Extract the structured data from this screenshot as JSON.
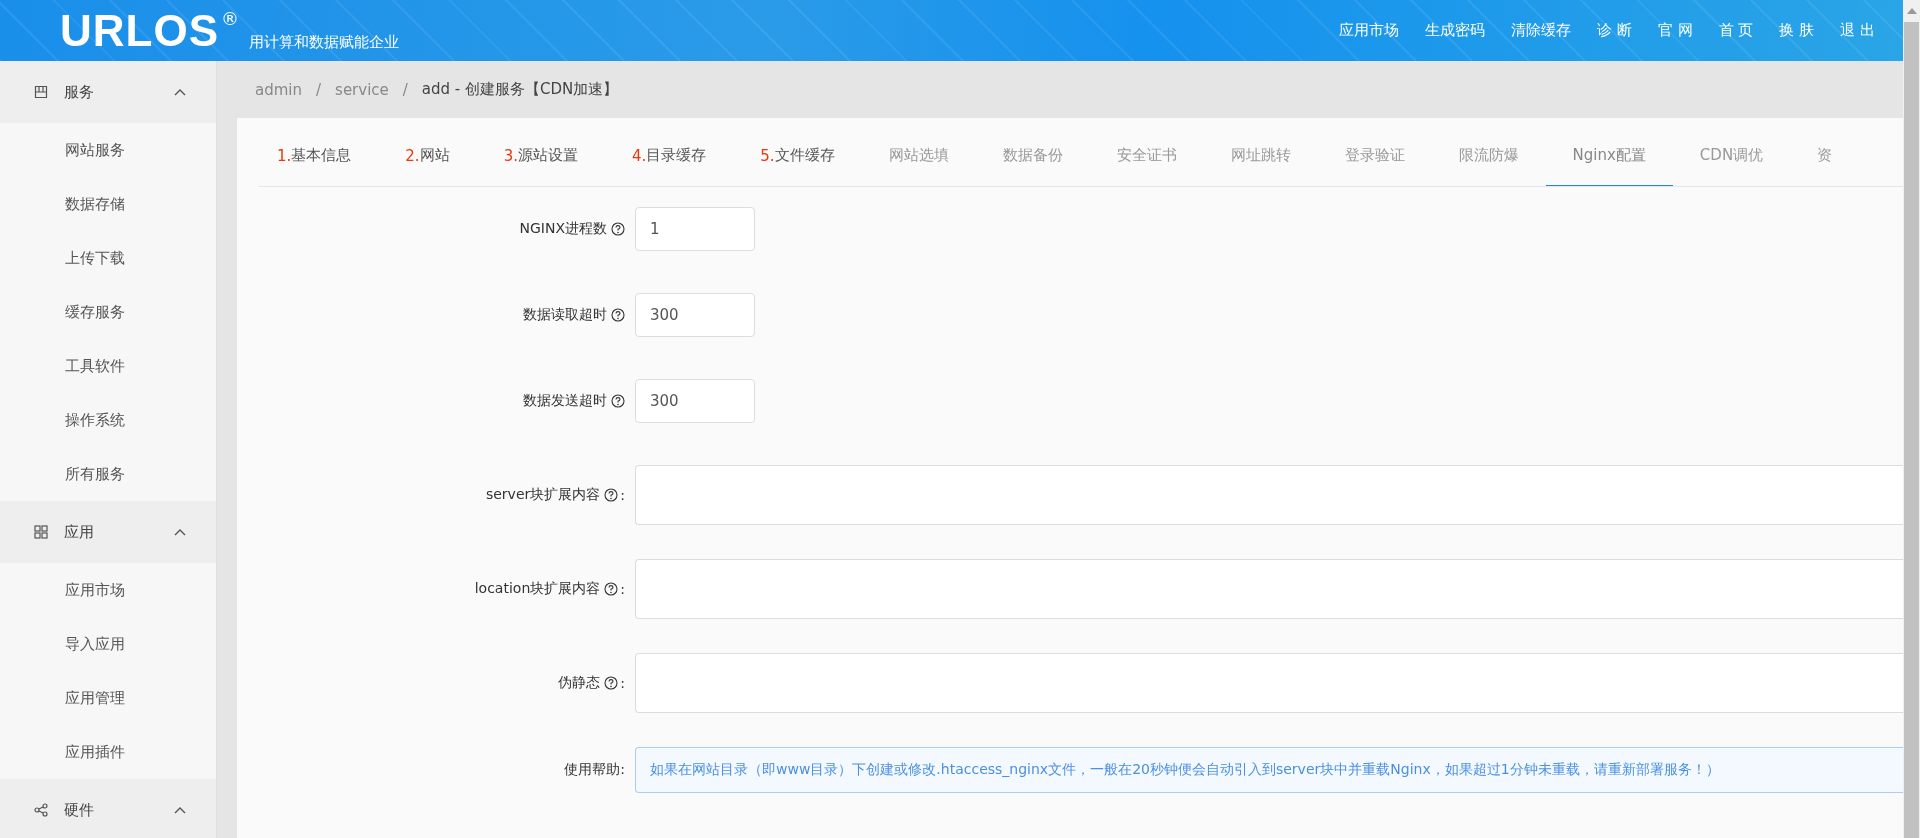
{
  "header": {
    "logo": "URLOS",
    "registered": "®",
    "tagline": "用计算和数据赋能企业",
    "nav": [
      "应用市场",
      "生成密码",
      "清除缓存",
      "诊 断",
      "官 网",
      "首 页",
      "换 肤",
      "退 出"
    ]
  },
  "sidebar": {
    "groups": [
      {
        "label": "服务",
        "kind": "services",
        "expanded": true,
        "children": [
          "网站服务",
          "数据存储",
          "上传下载",
          "缓存服务",
          "工具软件",
          "操作系统",
          "所有服务"
        ]
      },
      {
        "label": "应用",
        "kind": "apps",
        "expanded": true,
        "children": [
          "应用市场",
          "导入应用",
          "应用管理",
          "应用插件"
        ]
      },
      {
        "label": "硬件",
        "kind": "hardware",
        "expanded": true
      }
    ]
  },
  "breadcrumb": [
    {
      "text": "admin",
      "kind": "link"
    },
    {
      "text": "/",
      "kind": "sep"
    },
    {
      "text": "service",
      "kind": "link"
    },
    {
      "text": "/",
      "kind": "sep"
    },
    {
      "text": "add - 创建服务【CDN加速】",
      "kind": "current"
    }
  ],
  "tabs": [
    {
      "number": "1.",
      "label": "基本信息",
      "selected": false
    },
    {
      "number": "2.",
      "label": "网站",
      "selected": false
    },
    {
      "number": "3.",
      "label": "源站设置",
      "selected": false
    },
    {
      "number": "4.",
      "label": "目录缓存",
      "selected": false
    },
    {
      "number": "5.",
      "label": "文件缓存",
      "selected": false
    },
    {
      "label": "网站选填",
      "selected": false
    },
    {
      "label": "数据备份",
      "selected": false
    },
    {
      "label": "安全证书",
      "selected": false
    },
    {
      "label": "网址跳转",
      "selected": false
    },
    {
      "label": "登录验证",
      "selected": false
    },
    {
      "label": "限流防爆",
      "selected": false
    },
    {
      "label": "Nginx配置",
      "selected": true
    },
    {
      "label": "CDN调优",
      "selected": false
    },
    {
      "label": "资",
      "selected": false
    }
  ],
  "form": [
    {
      "kind": "number",
      "label": "NGINX进程数",
      "help_icon": true,
      "value": "1"
    },
    {
      "kind": "number",
      "label": "数据读取超时",
      "help_icon": true,
      "value": "300"
    },
    {
      "kind": "number",
      "label": "数据发送超时",
      "help_icon": true,
      "value": "300"
    },
    {
      "kind": "textarea",
      "label": "server块扩展内容",
      "help_icon": true,
      "suffix": ":"
    },
    {
      "kind": "textarea",
      "label": "location块扩展内容",
      "help_icon": true,
      "suffix": ":"
    },
    {
      "kind": "textarea",
      "label": "伪静态",
      "help_icon": true,
      "suffix": ":"
    },
    {
      "kind": "help",
      "label": "使用帮助:",
      "help_icon": false,
      "value": "如果在网站目录（即www目录）下创建或修改.htaccess_nginx文件，一般在20秒钟便会自动引入到server块中并重载Nginx，如果超过1分钟未重载，请重新部署服务！）"
    }
  ]
}
